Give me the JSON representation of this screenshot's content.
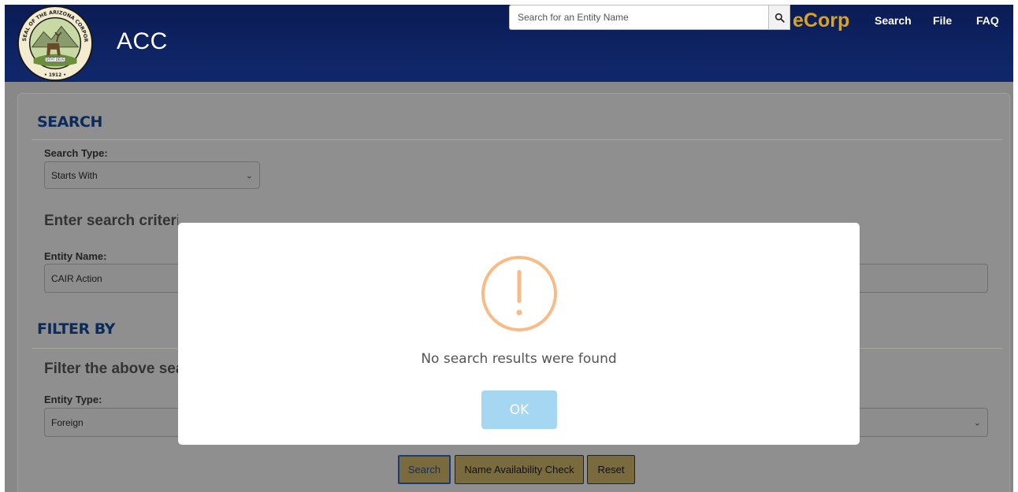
{
  "header": {
    "brand": "ACC",
    "seal_alt": "Seal of the Arizona Corporation Commission",
    "seal_text_top": "SEAL OF THE ARIZONA CORPORATION COMMISSION",
    "seal_motto": "DITAT DEUS",
    "seal_year": "1912",
    "search_placeholder": "Search for an Entity Name",
    "ecorp": "eCorp",
    "nav": [
      "Search",
      "File",
      "FAQ"
    ]
  },
  "search_section": {
    "title": "SEARCH",
    "search_type_label": "Search Type:",
    "search_type_value": "Starts With",
    "criteria_heading": "Enter search criteria into one of the below search fields (required):",
    "entity_name_label": "Entity Name:",
    "entity_name_value": "CAIR Action"
  },
  "filter_section": {
    "title": "FILTER BY",
    "heading": "Filter the above search",
    "entity_type_label": "Entity Type:",
    "entity_type_value": "Foreign"
  },
  "actions": {
    "search": "Search",
    "name_check": "Name Availability Check",
    "reset": "Reset"
  },
  "modal": {
    "icon": "warning-icon",
    "message": "No search results were found",
    "ok": "OK"
  },
  "colors": {
    "header_bg": "#0e2463",
    "ecorp_gold": "#d9a419",
    "warning": "#f8bb86",
    "ok_button": "#a5d7f3"
  }
}
